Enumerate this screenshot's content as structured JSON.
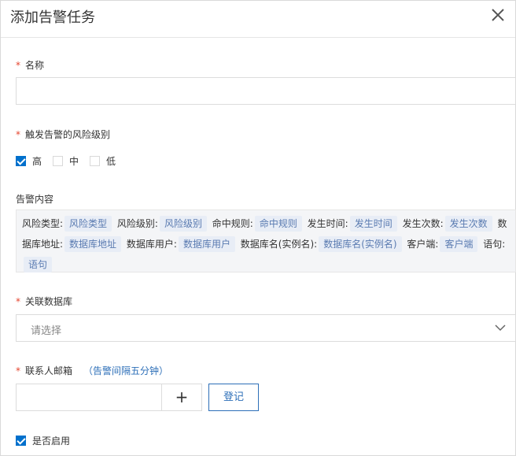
{
  "dialog": {
    "title": "添加告警任务",
    "close_icon": "close-icon"
  },
  "name_field": {
    "label": "名称",
    "required_mark": "*",
    "value": "",
    "placeholder": ""
  },
  "risk_level": {
    "label": "触发告警的风险级别",
    "required_mark": "*",
    "options": [
      {
        "label": "高",
        "checked": true
      },
      {
        "label": "中",
        "checked": false
      },
      {
        "label": "低",
        "checked": false
      }
    ]
  },
  "alert_content": {
    "label": "告警内容",
    "items": [
      {
        "key": "风险类型:",
        "tag": "风险类型"
      },
      {
        "key": "风险级别:",
        "tag": "风险级别"
      },
      {
        "key": "命中规则:",
        "tag": "命中规则"
      },
      {
        "key": "发生时间:",
        "tag": "发生时间"
      },
      {
        "key": "发生次数:",
        "tag": "发生次数"
      },
      {
        "key": "数据库地址:",
        "tag": "数据库地址"
      },
      {
        "key": "数据库用户:",
        "tag": "数据库用户"
      },
      {
        "key": "数据库名(实例名):",
        "tag": "数据库名(实例名)"
      },
      {
        "key": "客户端:",
        "tag": "客户端"
      },
      {
        "key": "语句:",
        "tag": "语句"
      }
    ]
  },
  "database": {
    "label": "关联数据库",
    "required_mark": "*",
    "placeholder": "请选择",
    "chevron_icon": "chevron-down-icon"
  },
  "email": {
    "label": "联系人邮箱",
    "required_mark": "*",
    "hint": "（告警间隔五分钟）",
    "value": "",
    "add_label": "+",
    "register_label": "登记"
  },
  "enabled": {
    "label": "是否启用",
    "checked": true
  },
  "colors": {
    "accent": "#0070cc",
    "link": "#2d6fb8",
    "required": "#e5452f",
    "tag_bg": "#e8edf6",
    "tag_text": "#5a7bb1"
  }
}
